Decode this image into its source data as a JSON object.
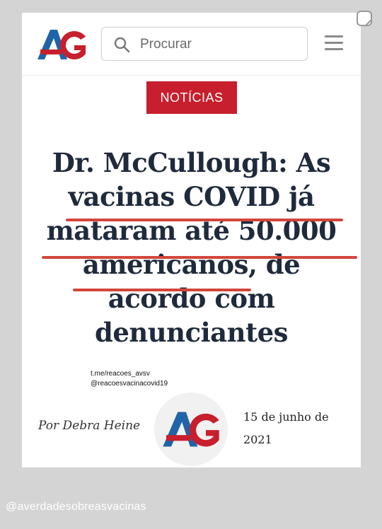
{
  "header": {
    "logo_text": "AG",
    "search": {
      "placeholder": "Procurar"
    }
  },
  "article": {
    "category_label": "NOTÍCIAS",
    "headline_lines": [
      "Dr. McCullough: As",
      "vacinas COVID já",
      "mataram até 50.000",
      "americanos, de",
      "acordo com",
      "denunciantes"
    ],
    "author": "Por Debra Heine",
    "date_lines": [
      "15 de junho de",
      "2021"
    ]
  },
  "watermark": {
    "line1": "t.me/reacoes_avsv",
    "line2": "@reacoesvacinacovid19"
  },
  "footer": {
    "handle": "@averdadesobreasvacinas"
  },
  "colors": {
    "brand_red": "#c71f2d",
    "brand_blue": "#1f64a8",
    "headline": "#1f2a3c",
    "underline": "#d2463a"
  },
  "icons": [
    "search-icon",
    "menu-icon",
    "brand-logo",
    "story-sticker-icon"
  ]
}
